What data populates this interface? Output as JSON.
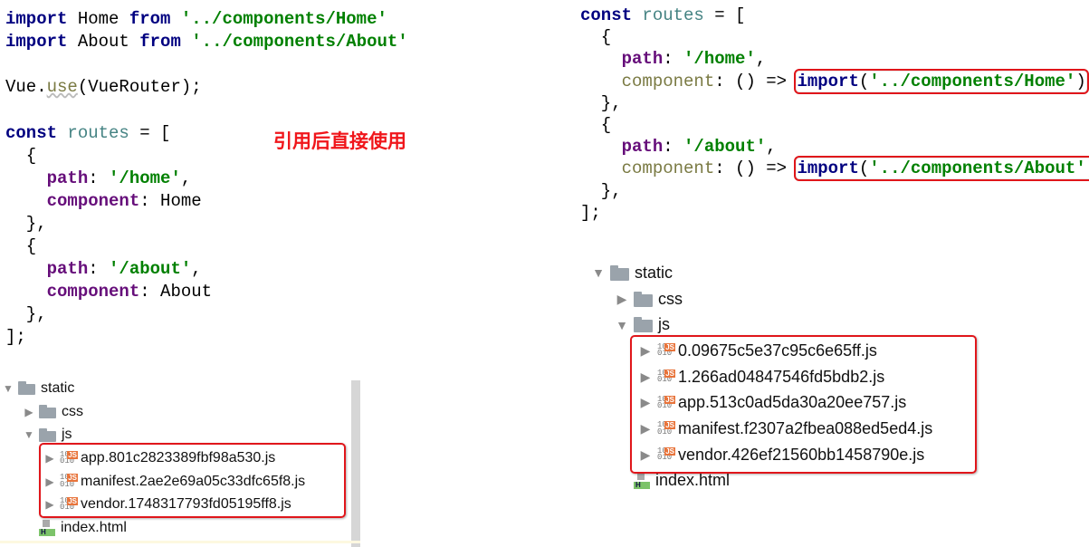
{
  "left_code": [
    [
      {
        "t": "import",
        "c": "kw"
      },
      {
        "t": " Home ",
        "c": "p"
      },
      {
        "t": "from",
        "c": "kw"
      },
      {
        "t": " '../components/Home'",
        "c": "str"
      }
    ],
    [
      {
        "t": "import",
        "c": "kw"
      },
      {
        "t": " About ",
        "c": "p"
      },
      {
        "t": "from",
        "c": "kw"
      },
      {
        "t": " '../components/About'",
        "c": "str"
      }
    ],
    [],
    [
      {
        "t": "Vue.",
        "c": "p"
      },
      {
        "t": "use",
        "c": "fn"
      },
      {
        "t": "(VueRouter);",
        "c": "p"
      }
    ],
    [],
    [
      {
        "t": "const",
        "c": "kw"
      },
      {
        "t": " ",
        "c": "p"
      },
      {
        "t": "routes",
        "c": "var"
      },
      {
        "t": " = [",
        "c": "p"
      }
    ],
    [
      {
        "t": "  {",
        "c": "p"
      }
    ],
    [
      {
        "t": "    ",
        "c": "p"
      },
      {
        "t": "path",
        "c": "prop"
      },
      {
        "t": ": ",
        "c": "p"
      },
      {
        "t": "'/home'",
        "c": "str"
      },
      {
        "t": ",",
        "c": "p"
      }
    ],
    [
      {
        "t": "    ",
        "c": "p"
      },
      {
        "t": "component",
        "c": "prop"
      },
      {
        "t": ": Home",
        "c": "p"
      }
    ],
    [
      {
        "t": "  },",
        "c": "p"
      }
    ],
    [
      {
        "t": "  {",
        "c": "p"
      }
    ],
    [
      {
        "t": "    ",
        "c": "p"
      },
      {
        "t": "path",
        "c": "prop"
      },
      {
        "t": ": ",
        "c": "p"
      },
      {
        "t": "'/about'",
        "c": "str"
      },
      {
        "t": ",",
        "c": "p"
      }
    ],
    [
      {
        "t": "    ",
        "c": "p"
      },
      {
        "t": "component",
        "c": "prop"
      },
      {
        "t": ": About",
        "c": "p"
      }
    ],
    [
      {
        "t": "  },",
        "c": "p"
      }
    ],
    [
      {
        "t": "];",
        "c": "p"
      }
    ]
  ],
  "annotation": "引用后直接使用",
  "right_code": [
    [
      {
        "t": "const",
        "c": "kw"
      },
      {
        "t": " ",
        "c": "p"
      },
      {
        "t": "routes",
        "c": "var"
      },
      {
        "t": " = [",
        "c": "p"
      }
    ],
    [
      {
        "t": "  {",
        "c": "p"
      }
    ],
    [
      {
        "t": "    ",
        "c": "p"
      },
      {
        "t": "path",
        "c": "prop"
      },
      {
        "t": ": ",
        "c": "p"
      },
      {
        "t": "'/home'",
        "c": "str"
      },
      {
        "t": ",",
        "c": "p"
      }
    ],
    [
      {
        "t": "    ",
        "c": "p"
      },
      {
        "t": "component",
        "c": "olive"
      },
      {
        "t": ": () => ",
        "c": "p"
      },
      {
        "group": "highlight",
        "tokens": [
          {
            "t": "import",
            "c": "kw"
          },
          {
            "t": "(",
            "c": "p"
          },
          {
            "t": "'../components/Home'",
            "c": "str"
          },
          {
            "t": ")",
            "c": "p"
          }
        ]
      }
    ],
    [
      {
        "t": "  },",
        "c": "p"
      }
    ],
    [
      {
        "t": "  {",
        "c": "p"
      }
    ],
    [
      {
        "t": "    ",
        "c": "p"
      },
      {
        "t": "path",
        "c": "prop"
      },
      {
        "t": ": ",
        "c": "p"
      },
      {
        "t": "'/about'",
        "c": "str"
      },
      {
        "t": ",",
        "c": "p"
      }
    ],
    [
      {
        "t": "    ",
        "c": "p"
      },
      {
        "t": "component",
        "c": "olive"
      },
      {
        "t": ": () => ",
        "c": "p"
      },
      {
        "group": "highlight",
        "tokens": [
          {
            "t": "import",
            "c": "kw"
          },
          {
            "t": "(",
            "c": "p"
          },
          {
            "t": "'../components/About'",
            "c": "str"
          },
          {
            "t": ")",
            "c": "p"
          }
        ]
      }
    ],
    [
      {
        "t": "  },",
        "c": "p"
      }
    ],
    [
      {
        "t": "];",
        "c": "p"
      }
    ]
  ],
  "left_tree": [
    {
      "label": "static",
      "type": "folder",
      "arrow": "expanded",
      "depth": 0
    },
    {
      "label": "css",
      "type": "folder",
      "arrow": "collapsed",
      "depth": 1
    },
    {
      "label": "js",
      "type": "folder",
      "arrow": "expanded",
      "depth": 1
    },
    {
      "label": "app.801c2823389fbf98a530.js",
      "type": "js",
      "arrow": "collapsed",
      "depth": 2
    },
    {
      "label": "manifest.2ae2e69a05c33dfc65f8.js",
      "type": "js",
      "arrow": "collapsed",
      "depth": 2
    },
    {
      "label": "vendor.1748317793fd05195ff8.js",
      "type": "js",
      "arrow": "collapsed",
      "depth": 2
    },
    {
      "label": "index.html",
      "type": "html",
      "arrow": "none",
      "depth": 1
    }
  ],
  "right_tree": [
    {
      "label": "static",
      "type": "folder",
      "arrow": "expanded",
      "depth": 0
    },
    {
      "label": "css",
      "type": "folder",
      "arrow": "collapsed",
      "depth": 1
    },
    {
      "label": "js",
      "type": "folder",
      "arrow": "expanded",
      "depth": 1
    },
    {
      "label": "0.09675c5e37c95c6e65ff.js",
      "type": "js",
      "arrow": "collapsed",
      "depth": 2
    },
    {
      "label": "1.266ad04847546fd5bdb2.js",
      "type": "js",
      "arrow": "collapsed",
      "depth": 2
    },
    {
      "label": "app.513c0ad5da30a20ee757.js",
      "type": "js",
      "arrow": "collapsed",
      "depth": 2
    },
    {
      "label": "manifest.f2307a2fbea088ed5ed4.js",
      "type": "js",
      "arrow": "collapsed",
      "depth": 2
    },
    {
      "label": "vendor.426ef21560bb1458790e.js",
      "type": "js",
      "arrow": "collapsed",
      "depth": 2
    },
    {
      "label": "index.html",
      "type": "html",
      "arrow": "none",
      "depth": 1
    }
  ],
  "icons": {
    "folder": "folder-icon",
    "js": "js-file-icon",
    "html": "html-file-icon"
  },
  "colors": {
    "highlight_box": "#e0161b",
    "annotation": "#f0161b",
    "keyword": "#000080",
    "string": "#008000",
    "property": "#660e7a"
  }
}
